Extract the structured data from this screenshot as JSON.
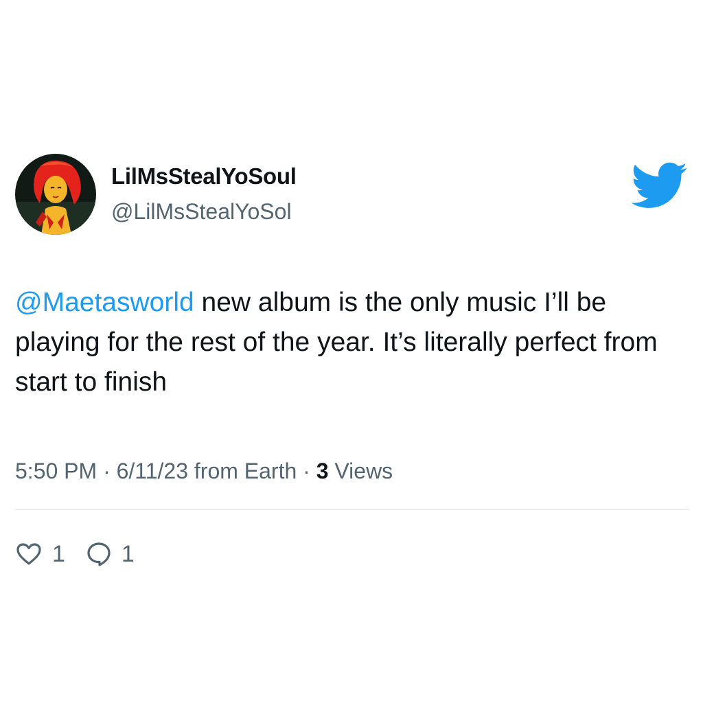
{
  "author": {
    "display_name": "LilMsStealYoSoul",
    "handle": "@LilMsStealYoSol",
    "avatar_icon": "cartoon-girl-red-hair-avatar"
  },
  "logo": {
    "icon": "twitter-bird-icon",
    "color": "#1d9bf0"
  },
  "tweet": {
    "mention": "@Maetasworld",
    "text": " new album is the only music I’ll be playing for the rest of the year. It’s literally perfect from start to finish"
  },
  "meta": {
    "time": "5:50 PM",
    "sep1": " · ",
    "date": "6/11/23",
    "source": " from Earth",
    "sep2": " · ",
    "views_count": "3",
    "views_label": " Views"
  },
  "actions": {
    "like_icon": "heart-icon",
    "like_count": "1",
    "reply_icon": "comment-icon",
    "reply_count": "1"
  },
  "colors": {
    "accent": "#1d9bf0",
    "text": "#0f1419",
    "secondary": "#536471",
    "divider": "#e6e9eb"
  }
}
